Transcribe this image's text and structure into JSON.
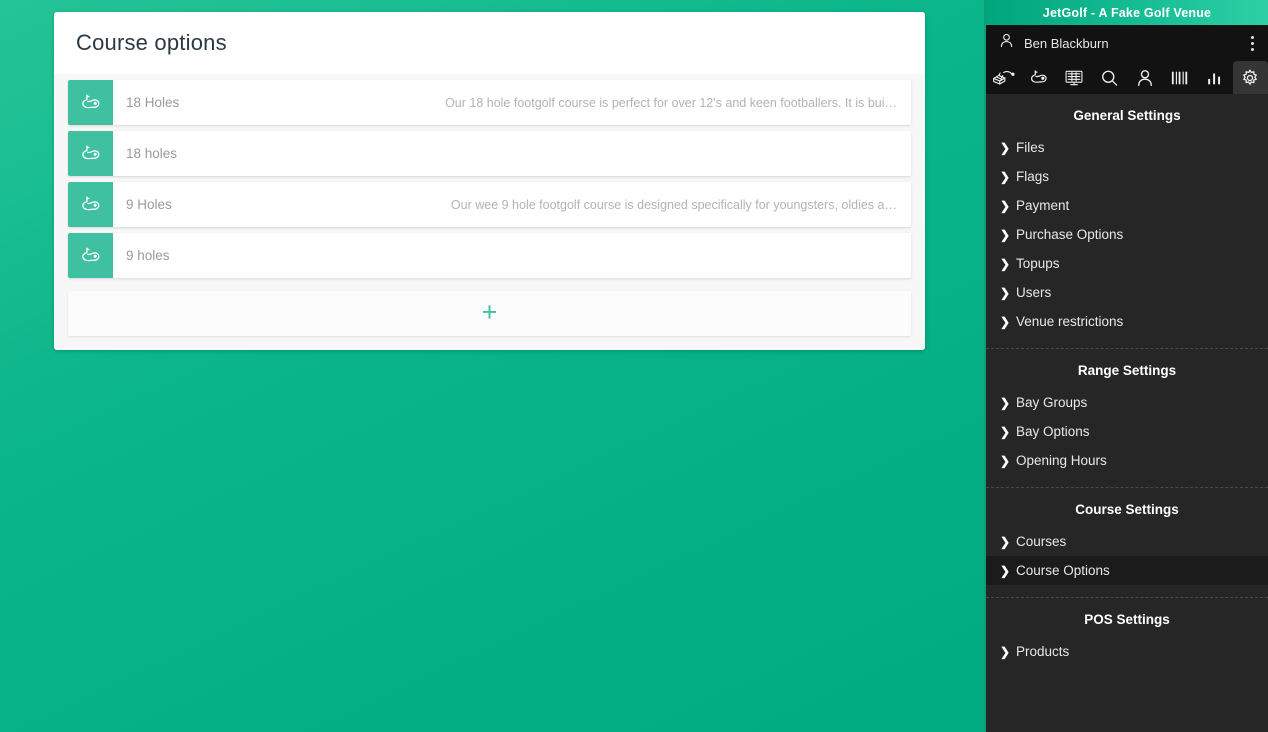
{
  "window": {
    "title": "JetGolf - A Fake Golf Venue"
  },
  "user_bar": {
    "user_icon": "person-icon",
    "user_name": "Ben Blackburn",
    "menu_icon": "kebab-menu-icon"
  },
  "toolbar": {
    "icons": [
      {
        "name": "driving-range-icon",
        "label": "Driving Range"
      },
      {
        "name": "golf-course-icon",
        "label": "Golf Course"
      },
      {
        "name": "scoreboard-icon",
        "label": "Scoreboard"
      },
      {
        "name": "search-icon",
        "label": "Search"
      },
      {
        "name": "person-icon",
        "label": "Customers"
      },
      {
        "name": "barcode-icon",
        "label": "Barcode"
      },
      {
        "name": "bar-chart-icon",
        "label": "Reports"
      },
      {
        "name": "gear-icon",
        "label": "Settings"
      }
    ],
    "active_index": 7
  },
  "sidebar": {
    "sections": [
      {
        "title": "General Settings",
        "items": [
          {
            "label": "Files",
            "active": false
          },
          {
            "label": "Flags",
            "active": false
          },
          {
            "label": "Payment",
            "active": false
          },
          {
            "label": "Purchase Options",
            "active": false
          },
          {
            "label": "Topups",
            "active": false
          },
          {
            "label": "Users",
            "active": false
          },
          {
            "label": "Venue restrictions",
            "active": false
          }
        ]
      },
      {
        "title": "Range Settings",
        "items": [
          {
            "label": "Bay Groups",
            "active": false
          },
          {
            "label": "Bay Options",
            "active": false
          },
          {
            "label": "Opening Hours",
            "active": false
          }
        ]
      },
      {
        "title": "Course Settings",
        "items": [
          {
            "label": "Courses",
            "active": false
          },
          {
            "label": "Course Options",
            "active": true
          }
        ]
      },
      {
        "title": "POS Settings",
        "items": [
          {
            "label": "Products",
            "active": false
          }
        ]
      }
    ],
    "chevron_glyph": "❯"
  },
  "main": {
    "panel_title": "Course options",
    "add_label": "+",
    "rows": [
      {
        "icon": "golf-course-icon",
        "name": "18 Holes",
        "description": "Our 18 hole footgolf course is perfect for over 12's and keen footballers. It is bui…"
      },
      {
        "icon": "golf-course-icon",
        "name": "18 holes",
        "description": ""
      },
      {
        "icon": "golf-course-icon",
        "name": "9 Holes",
        "description": "Our wee 9 hole footgolf course is designed specifically for youngsters, oldies a…"
      },
      {
        "icon": "golf-course-icon",
        "name": "9 holes",
        "description": ""
      }
    ]
  },
  "colors": {
    "brand_green": "#00b087",
    "accent_green": "#3fc0a0",
    "sidebar_bg": "#262626",
    "sidebar_dark": "#121212",
    "active_item_bg": "#1b1b1b",
    "panel_bg": "#ffffff",
    "panel_body_bg": "#f7f7f7",
    "text_muted": "#9a9a9a"
  }
}
